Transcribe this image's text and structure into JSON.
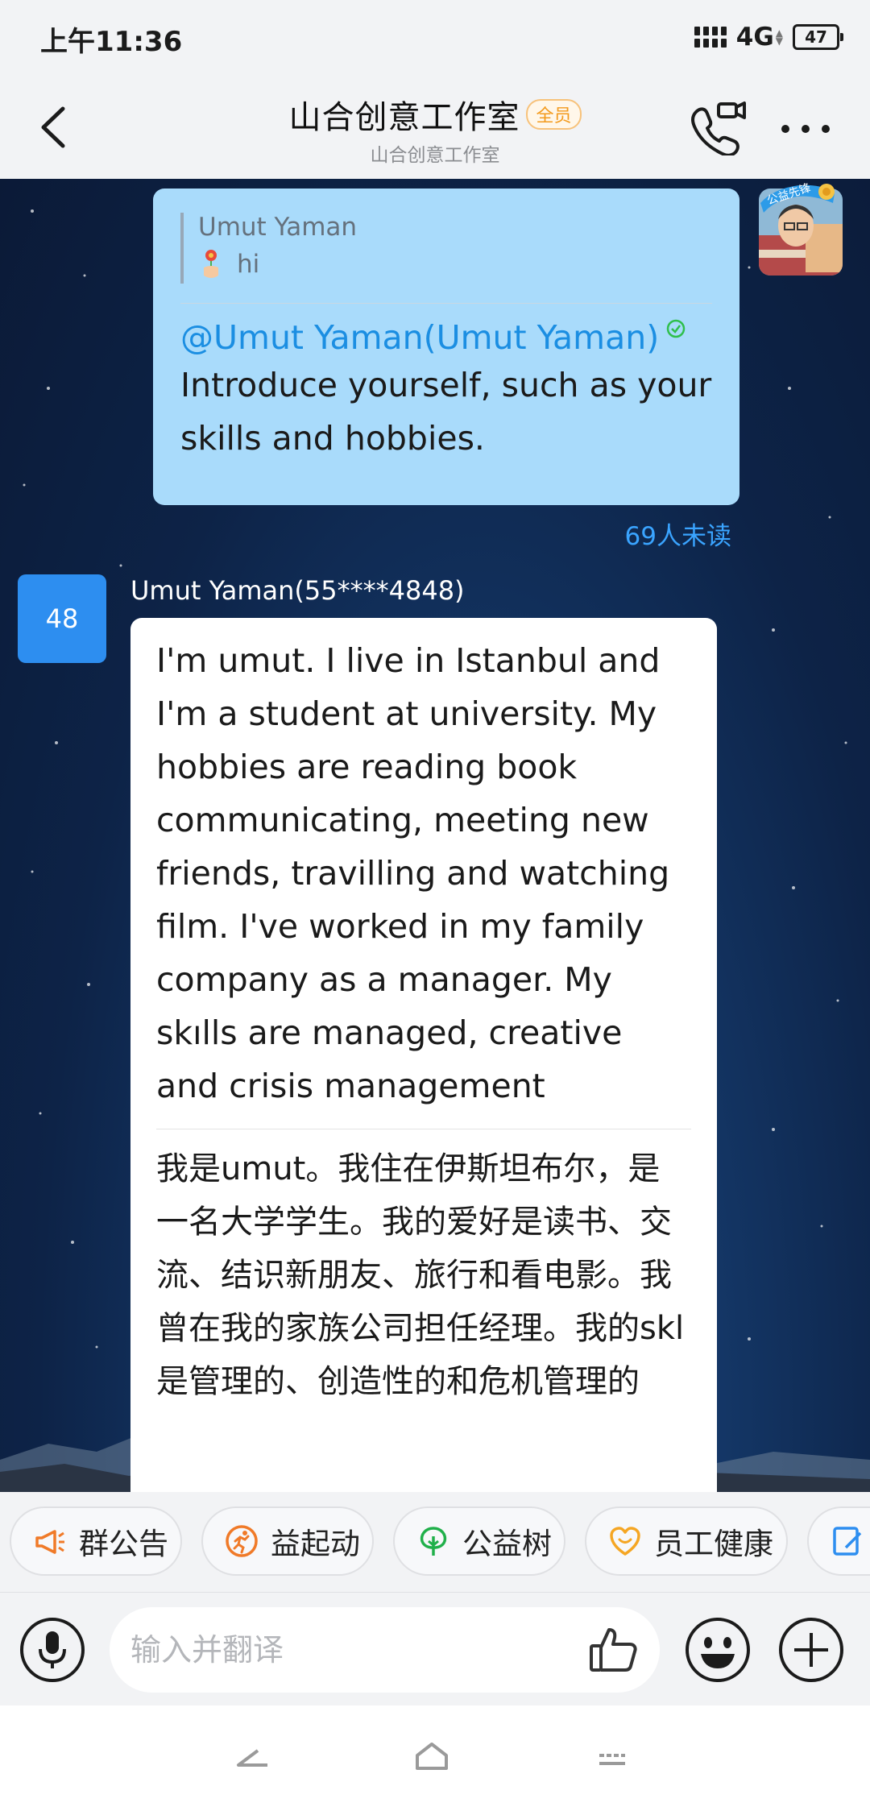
{
  "status_bar": {
    "time": "上午11:36",
    "network": "4G",
    "battery": "47"
  },
  "header": {
    "title": "山合创意工作室",
    "badge": "全员",
    "subtitle": "山合创意工作室"
  },
  "messages": {
    "sent": {
      "quote_author": "Umut Yaman",
      "quote_text": "hi",
      "mention": "@Umut Yaman(Umut Yaman)",
      "text": "Introduce yourself, such as your skills and hobbies.",
      "avatar_badge": "公益先锋",
      "read_status": "69人未读"
    },
    "received": {
      "avatar_label": "48",
      "sender": "Umut Yaman(55****4848)",
      "text": "I'm umut. I live in Istanbul and I'm a student at university. My hobbies are reading book communicating, meeting new friends, travilling and watching film. I've worked in my family company as a manager. My skılls are managed, creative and crisis management",
      "translation": "我是umut。我住在伊斯坦布尔，是一名大学学生。我的爱好是读书、交流、结识新朋友、旅行和看电影。我曾在我的家族公司担任经理。我的skl是管理的、创造性的和危机管理的"
    }
  },
  "quick_bar": {
    "items": [
      {
        "label": "群公告",
        "icon": "megaphone-icon",
        "color": "#f07a28"
      },
      {
        "label": "益起动",
        "icon": "runner-icon",
        "color": "#f07a28"
      },
      {
        "label": "公益树",
        "icon": "tree-icon",
        "color": "#20b04a"
      },
      {
        "label": "员工健康",
        "icon": "heart-icon",
        "color": "#f5a623"
      }
    ]
  },
  "input": {
    "placeholder": "输入并翻译"
  },
  "colors": {
    "accent": "#1b8ee2",
    "sent_bubble": "#a9dbfb",
    "sender_avatar": "#2d8ef0"
  }
}
